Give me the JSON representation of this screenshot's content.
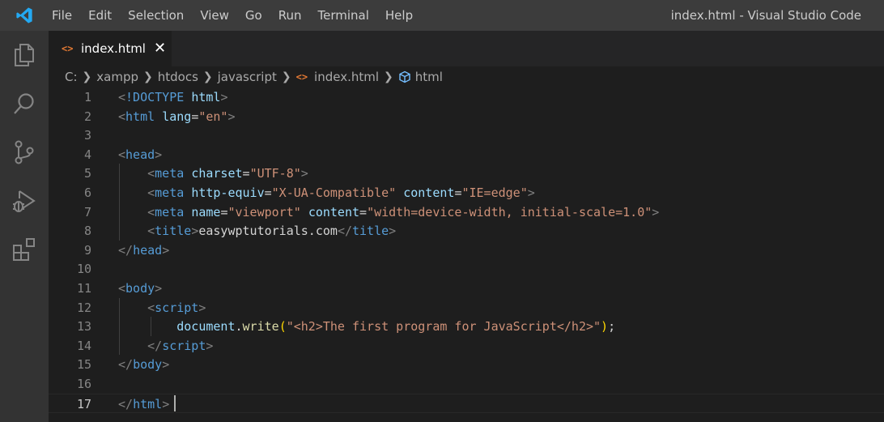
{
  "titlebar": {
    "menu": [
      "File",
      "Edit",
      "Selection",
      "View",
      "Go",
      "Run",
      "Terminal",
      "Help"
    ],
    "window_title": "index.html - Visual Studio Code"
  },
  "activitybar": {
    "icons": [
      "explorer-icon",
      "search-icon",
      "source-control-icon",
      "run-debug-icon",
      "extensions-icon"
    ]
  },
  "tab": {
    "icon": "<>",
    "label": "index.html",
    "close": "✕"
  },
  "breadcrumb": {
    "items": [
      "C:",
      "xampp",
      "htdocs",
      "javascript",
      "index.html",
      "html"
    ],
    "file_icon": "<>"
  },
  "editor": {
    "active_line": 17,
    "line_numbers": [
      "1",
      "2",
      "3",
      "4",
      "5",
      "6",
      "7",
      "8",
      "9",
      "10",
      "11",
      "12",
      "13",
      "14",
      "15",
      "16",
      "17"
    ],
    "lines": [
      [
        [
          "punc",
          "<"
        ],
        [
          "tag",
          "!DOCTYPE"
        ],
        [
          "txt",
          " "
        ],
        [
          "attr",
          "html"
        ],
        [
          "punc",
          ">"
        ]
      ],
      [
        [
          "punc",
          "<"
        ],
        [
          "tag",
          "html"
        ],
        [
          "txt",
          " "
        ],
        [
          "attr",
          "lang"
        ],
        [
          "txt",
          "="
        ],
        [
          "str",
          "\"en\""
        ],
        [
          "punc",
          ">"
        ]
      ],
      [],
      [
        [
          "punc",
          "<"
        ],
        [
          "tag",
          "head"
        ],
        [
          "punc",
          ">"
        ]
      ],
      [
        [
          "txt",
          "    "
        ],
        [
          "punc",
          "<"
        ],
        [
          "tag",
          "meta"
        ],
        [
          "txt",
          " "
        ],
        [
          "attr",
          "charset"
        ],
        [
          "txt",
          "="
        ],
        [
          "str",
          "\"UTF-8\""
        ],
        [
          "punc",
          ">"
        ]
      ],
      [
        [
          "txt",
          "    "
        ],
        [
          "punc",
          "<"
        ],
        [
          "tag",
          "meta"
        ],
        [
          "txt",
          " "
        ],
        [
          "attr",
          "http-equiv"
        ],
        [
          "txt",
          "="
        ],
        [
          "str",
          "\"X-UA-Compatible\""
        ],
        [
          "txt",
          " "
        ],
        [
          "attr",
          "content"
        ],
        [
          "txt",
          "="
        ],
        [
          "str",
          "\"IE=edge\""
        ],
        [
          "punc",
          ">"
        ]
      ],
      [
        [
          "txt",
          "    "
        ],
        [
          "punc",
          "<"
        ],
        [
          "tag",
          "meta"
        ],
        [
          "txt",
          " "
        ],
        [
          "attr",
          "name"
        ],
        [
          "txt",
          "="
        ],
        [
          "str",
          "\"viewport\""
        ],
        [
          "txt",
          " "
        ],
        [
          "attr",
          "content"
        ],
        [
          "txt",
          "="
        ],
        [
          "str",
          "\"width=device-width, initial-scale=1.0\""
        ],
        [
          "punc",
          ">"
        ]
      ],
      [
        [
          "txt",
          "    "
        ],
        [
          "punc",
          "<"
        ],
        [
          "tag",
          "title"
        ],
        [
          "punc",
          ">"
        ],
        [
          "txt",
          "easywptutorials.com"
        ],
        [
          "punc",
          "</"
        ],
        [
          "tag",
          "title"
        ],
        [
          "punc",
          ">"
        ]
      ],
      [
        [
          "punc",
          "</"
        ],
        [
          "tag",
          "head"
        ],
        [
          "punc",
          ">"
        ]
      ],
      [],
      [
        [
          "punc",
          "<"
        ],
        [
          "tag",
          "body"
        ],
        [
          "punc",
          ">"
        ]
      ],
      [
        [
          "txt",
          "    "
        ],
        [
          "punc",
          "<"
        ],
        [
          "tag",
          "script"
        ],
        [
          "punc",
          ">"
        ]
      ],
      [
        [
          "txt",
          "        "
        ],
        [
          "var",
          "document"
        ],
        [
          "txt",
          "."
        ],
        [
          "fn",
          "write"
        ],
        [
          "paren",
          "("
        ],
        [
          "str",
          "\"<h2>The first program for JavaScript</h2>\""
        ],
        [
          "paren",
          ")"
        ],
        [
          "txt",
          ";"
        ]
      ],
      [
        [
          "txt",
          "    "
        ],
        [
          "punc",
          "</"
        ],
        [
          "tag",
          "script"
        ],
        [
          "punc",
          ">"
        ]
      ],
      [
        [
          "punc",
          "</"
        ],
        [
          "tag",
          "body"
        ],
        [
          "punc",
          ">"
        ]
      ],
      [],
      [
        [
          "punc",
          "</"
        ],
        [
          "tag",
          "html"
        ],
        [
          "punc",
          ">"
        ]
      ]
    ]
  },
  "colors": {
    "tag": "#569cd6",
    "attr": "#9cdcfe",
    "string": "#ce9178",
    "punctuation": "#808080",
    "function": "#dcdcaa",
    "html_icon": "#e37933",
    "vscode_blue": "#23a9f2"
  }
}
